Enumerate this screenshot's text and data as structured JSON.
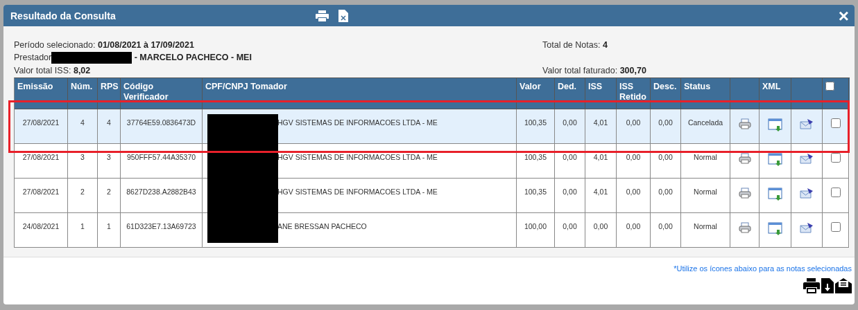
{
  "dialog": {
    "title": "Resultado da Consulta",
    "close": "×"
  },
  "summary": {
    "period_label": "Período selecionado:",
    "period_value": "01/08/2021 à 17/09/2021",
    "provider_label": "Prestador",
    "provider_value": "- MARCELO PACHECO - MEI",
    "iss_label": "Valor total ISS:",
    "iss_value": "8,02",
    "count_label": "Total de Notas:",
    "count_value": "4",
    "billed_label": "Valor total faturado:",
    "billed_value": "300,70"
  },
  "table": {
    "columns": [
      {
        "kind": "text",
        "label": "Emissão"
      },
      {
        "kind": "text",
        "label": "Núm."
      },
      {
        "kind": "text",
        "label": "RPS"
      },
      {
        "kind": "text",
        "label": "Código Verificador"
      },
      {
        "kind": "party",
        "label": "CPF/CNPJ Tomador"
      },
      {
        "kind": "text",
        "label": "Valor"
      },
      {
        "kind": "text",
        "label": "Ded."
      },
      {
        "kind": "text",
        "label": "ISS"
      },
      {
        "kind": "text",
        "label": "ISS Retido"
      },
      {
        "kind": "text",
        "label": "Desc."
      },
      {
        "kind": "text",
        "label": "Status"
      },
      {
        "kind": "print"
      },
      {
        "kind": "xml",
        "label": "XML"
      },
      {
        "kind": "email"
      },
      {
        "kind": "select",
        "checked": false
      }
    ],
    "rows": [
      {
        "selected": true,
        "checked": false,
        "cells": [
          "27/08/2021",
          "4",
          "4",
          "37764E59.0836473D",
          "HGV SISTEMAS DE INFORMACOES LTDA - ME",
          "100,35",
          "0,00",
          "4,01",
          "0,00",
          "0,00",
          "Cancelada"
        ]
      },
      {
        "selected": false,
        "checked": false,
        "cells": [
          "27/08/2021",
          "3",
          "3",
          "950FFF57.44A35370",
          "HGV SISTEMAS DE INFORMACOES LTDA - ME",
          "100,35",
          "0,00",
          "4,01",
          "0,00",
          "0,00",
          "Normal"
        ]
      },
      {
        "selected": false,
        "checked": false,
        "cells": [
          "27/08/2021",
          "2",
          "2",
          "8627D238.A2882B43",
          "HGV SISTEMAS DE INFORMACOES LTDA - ME",
          "100,35",
          "0,00",
          "4,01",
          "0,00",
          "0,00",
          "Normal"
        ]
      },
      {
        "selected": false,
        "checked": false,
        "cells": [
          "24/08/2021",
          "1",
          "1",
          "61D323E7.13A69723",
          "ANE BRESSAN PACHECO",
          "100,00",
          "0,00",
          "0,00",
          "0,00",
          "0,00",
          "Normal"
        ]
      }
    ]
  },
  "footer": {
    "hint": "*Utilize os ícones abaixo para as notas selecionadas"
  }
}
